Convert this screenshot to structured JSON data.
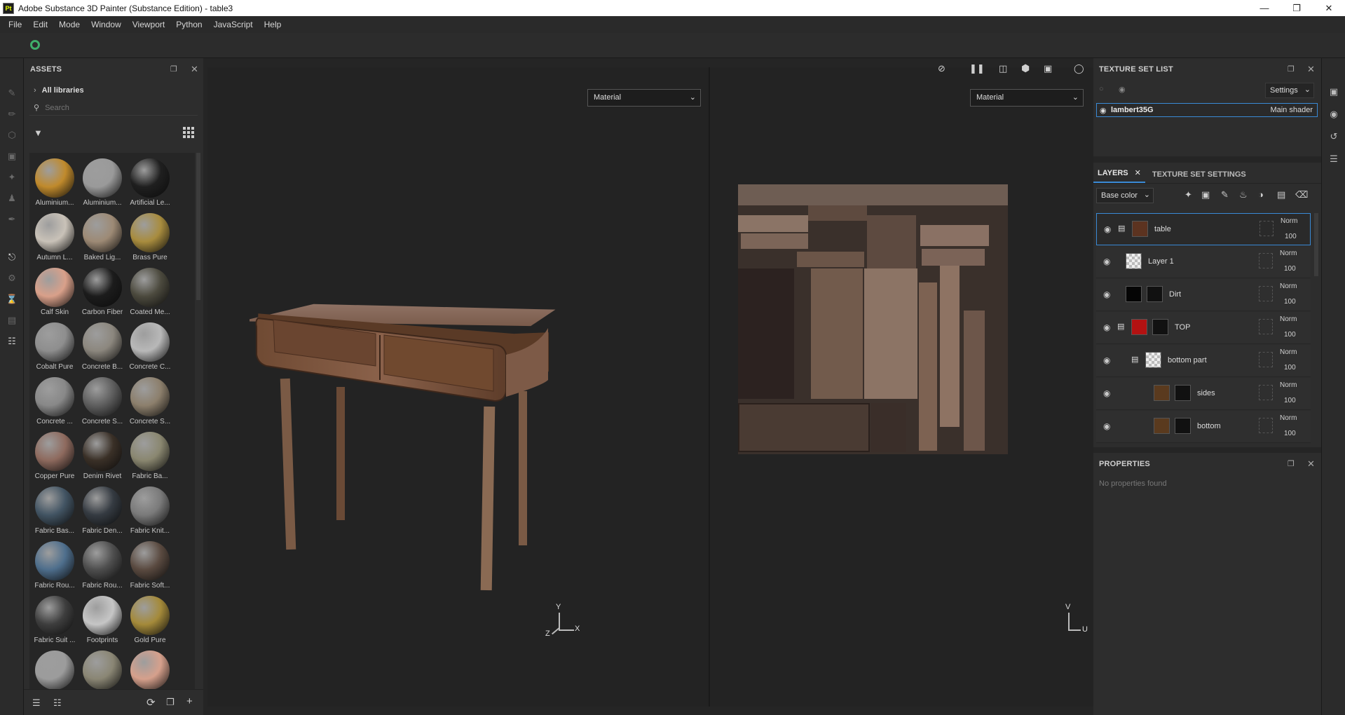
{
  "window": {
    "title": "Adobe Substance 3D Painter (Substance Edition) - table3",
    "app_badge": "Pt"
  },
  "menu": [
    "File",
    "Edit",
    "Mode",
    "Window",
    "Viewport",
    "Python",
    "JavaScript",
    "Help"
  ],
  "assets": {
    "title": "ASSETS",
    "breadcrumb": "All libraries",
    "search_placeholder": "Search",
    "materials": [
      {
        "label": "Aluminium...",
        "color": "#c08a2c"
      },
      {
        "label": "Aluminium...",
        "color": "#9a9a9a"
      },
      {
        "label": "Artificial Le...",
        "color": "#1f1f1f"
      },
      {
        "label": "Autumn L...",
        "color": "#c9c2b8"
      },
      {
        "label": "Baked Lig...",
        "color": "#9d8a75"
      },
      {
        "label": "Brass Pure",
        "color": "#a88c3e"
      },
      {
        "label": "Calf Skin",
        "color": "#d9a08a"
      },
      {
        "label": "Carbon Fiber",
        "color": "#1c1c1c"
      },
      {
        "label": "Coated Me...",
        "color": "#4c4a3e"
      },
      {
        "label": "Cobalt Pure",
        "color": "#8e8e8e"
      },
      {
        "label": "Concrete B...",
        "color": "#8c877e"
      },
      {
        "label": "Concrete C...",
        "color": "#b8b8b8"
      },
      {
        "label": "Concrete ...",
        "color": "#888888"
      },
      {
        "label": "Concrete S...",
        "color": "#5e5e5e"
      },
      {
        "label": "Concrete S...",
        "color": "#8c7f6c"
      },
      {
        "label": "Copper Pure",
        "color": "#8e6a5e"
      },
      {
        "label": "Denim Rivet",
        "color": "#3a3027"
      },
      {
        "label": "Fabric Ba...",
        "color": "#8a8770"
      },
      {
        "label": "Fabric Bas...",
        "color": "#425463"
      },
      {
        "label": "Fabric Den...",
        "color": "#353b42"
      },
      {
        "label": "Fabric Knit...",
        "color": "#7a7a7a"
      },
      {
        "label": "Fabric Rou...",
        "color": "#4e6e8c"
      },
      {
        "label": "Fabric Rou...",
        "color": "#4e4e4e"
      },
      {
        "label": "Fabric Soft...",
        "color": "#5a4a40"
      },
      {
        "label": "Fabric Suit ...",
        "color": "#3e3e3e"
      },
      {
        "label": "Footprints",
        "color": "#c6c6c6"
      },
      {
        "label": "Gold Pure",
        "color": "#a48a3a"
      },
      {
        "label": "",
        "color": "#9c9c9c"
      },
      {
        "label": "",
        "color": "#8a8674"
      },
      {
        "label": "",
        "color": "#d6a08c"
      }
    ]
  },
  "viewport": {
    "left_mode": "Material",
    "right_mode": "Material",
    "axis_3d": {
      "y": "Y",
      "z": "Z",
      "x": "X"
    },
    "axis_uv": {
      "v": "V",
      "u": "U"
    }
  },
  "texture_set_list": {
    "title": "TEXTURE SET LIST",
    "settings_label": "Settings",
    "set_name": "lambert35G",
    "shader": "Main shader"
  },
  "layers_panel": {
    "tabs": [
      "LAYERS",
      "TEXTURE SET SETTINGS"
    ],
    "channel": "Base color",
    "layers": [
      {
        "name": "table",
        "blend": "Norm",
        "opacity": "100",
        "thumb": "#5c3320",
        "selected": true
      },
      {
        "name": "Layer 1",
        "blend": "Norm",
        "opacity": "100",
        "thumb": "checker",
        "selected": false
      },
      {
        "name": "Dirt",
        "blend": "Norm",
        "opacity": "100",
        "thumb": "#050505",
        "selected": false
      },
      {
        "name": "TOP",
        "blend": "Norm",
        "opacity": "100",
        "thumb": "#b31212",
        "selected": false
      },
      {
        "name": "bottom part",
        "blend": "Norm",
        "opacity": "100",
        "thumb": "checker",
        "selected": false
      },
      {
        "name": "sides",
        "blend": "Norm",
        "opacity": "100",
        "thumb": "#5a3a1e",
        "selected": false
      },
      {
        "name": "bottom",
        "blend": "Norm",
        "opacity": "100",
        "thumb": "#5a3a1e",
        "selected": false
      }
    ]
  },
  "properties": {
    "title": "PROPERTIES",
    "empty": "No properties found"
  }
}
